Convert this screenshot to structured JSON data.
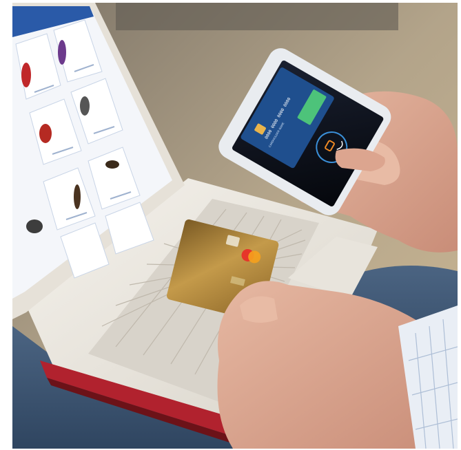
{
  "scene": {
    "description_tag": "photo",
    "phone_card": {
      "card_number": "0000 0000 0000 0000",
      "card_holder": "CARDHOLDER NAME"
    }
  },
  "colors": {
    "phone_screen": "#0a0e18",
    "card_blue": "#1f4f8e",
    "card_green": "#4dc37a",
    "nfc_orange": "#f08a24",
    "nfc_blue": "#3a8fd8",
    "credit_card_gold": "#a47a33",
    "laptop_shell": "#eeeae2",
    "laptop_accent_red": "#b1222e",
    "jeans": "#3b536f",
    "site_blue": "#2a5aa8"
  }
}
